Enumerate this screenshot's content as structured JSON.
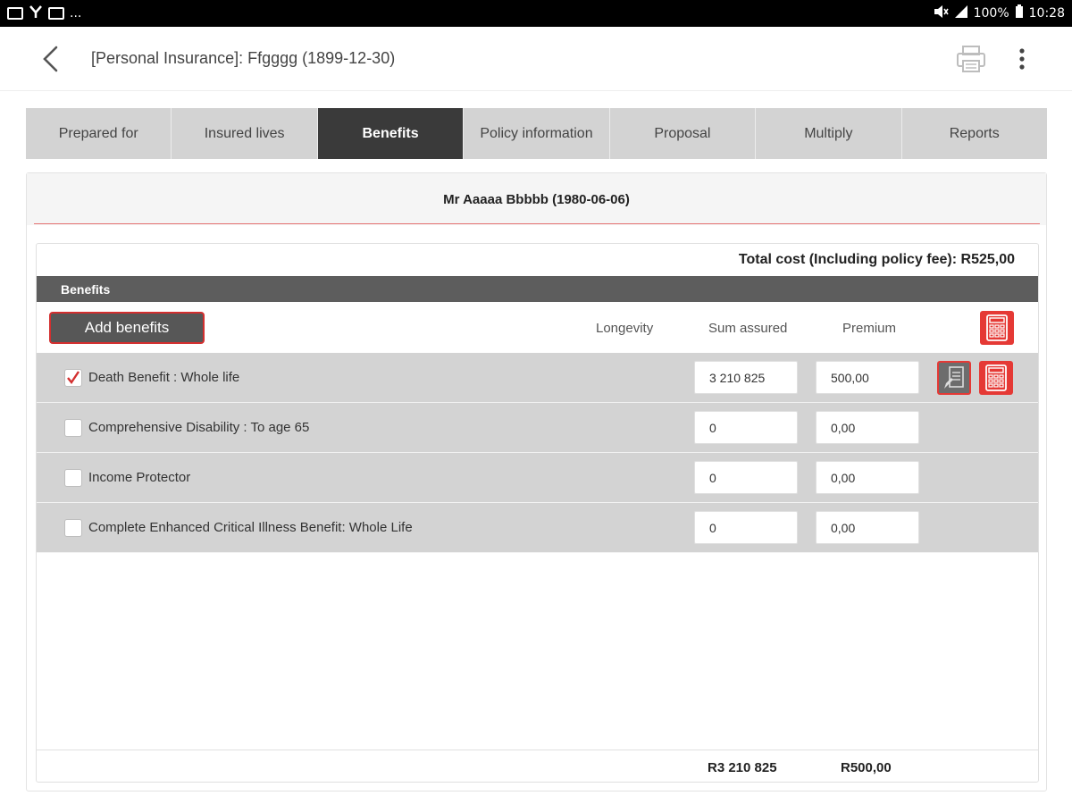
{
  "status_bar": {
    "left_ellipsis": "...",
    "battery": "100%",
    "time": "10:28"
  },
  "app_bar": {
    "title": "[Personal Insurance]: Ffgggg  (1899-12-30)"
  },
  "tabs": [
    {
      "label": "Prepared  for",
      "active": false
    },
    {
      "label": "Insured lives",
      "active": false
    },
    {
      "label": "Benefits",
      "active": true
    },
    {
      "label": "Policy information",
      "active": false
    },
    {
      "label": "Proposal",
      "active": false
    },
    {
      "label": "Multiply",
      "active": false
    },
    {
      "label": "Reports",
      "active": false
    }
  ],
  "person": {
    "name": "Mr Aaaaa Bbbbb (1980-06-06)"
  },
  "benefits": {
    "total_cost": "Total cost (Including policy fee): R525,00",
    "section_title": "Benefits",
    "add_button": "Add benefits",
    "col_longevity": "Longevity",
    "col_sum_assured": "Sum assured",
    "col_premium": "Premium",
    "rows": [
      {
        "label": "Death Benefit : Whole life",
        "checked": true,
        "sum_assured": "3 210 825",
        "premium": "500,00"
      },
      {
        "label": "Comprehensive Disability : To age 65",
        "checked": false,
        "sum_assured": "0",
        "premium": "0,00"
      },
      {
        "label": "Income Protector",
        "checked": false,
        "sum_assured": "0",
        "premium": "0,00"
      },
      {
        "label": "Complete Enhanced Critical Illness Benefit: Whole Life",
        "checked": false,
        "sum_assured": "0",
        "premium": "0,00"
      }
    ],
    "total_sum_assured": "R3 210 825",
    "total_premium": "R500,00"
  },
  "colors": {
    "accent": "#e53935",
    "active_tab": "#3a3a3a",
    "section_bar": "#5d5d5d",
    "row_bg": "#d3d3d3"
  }
}
